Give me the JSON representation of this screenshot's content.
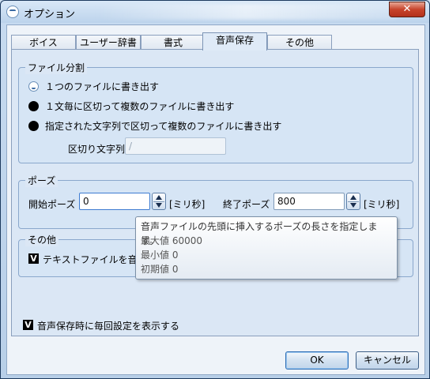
{
  "window": {
    "title": "オプション",
    "close_label": "✕"
  },
  "tabs": [
    {
      "label": "ボイス"
    },
    {
      "label": "ユーザー辞書"
    },
    {
      "label": "書式"
    },
    {
      "label": "音声保存",
      "active": true
    },
    {
      "label": "その他"
    }
  ],
  "file_split": {
    "title": "ファイル分割",
    "options": [
      {
        "label": "１つのファイルに書き出す",
        "selected": true
      },
      {
        "label": "１文毎に区切って複数のファイルに書き出す",
        "selected": false
      },
      {
        "label": "指定された文字列で区切って複数のファイルに書き出す",
        "selected": false
      }
    ],
    "delimiter_label": "区切り文字列",
    "delimiter_value": "/"
  },
  "pause": {
    "title": "ポーズ",
    "start_label": "開始ポーズ",
    "start_value": "0",
    "end_label": "終了ポーズ",
    "end_value": "800",
    "unit": "[ミリ秒]"
  },
  "other": {
    "title": "その他",
    "text_file_checkbox_label": "テキストファイルを音",
    "text_file_checked": true
  },
  "tooltip": {
    "line1": "音声ファイルの先頭に挿入するポーズの長さを指定します。",
    "line2": "最大値 60000",
    "line3": "最小値 0",
    "line4": "初期値 0"
  },
  "show_settings": {
    "label": "音声保存時に毎回設定を表示する",
    "checked": true
  },
  "checkbox_mark": "V",
  "buttons": {
    "ok": "OK",
    "cancel": "キャンセル"
  },
  "colors": {
    "accent": "#3a6aa3",
    "close_button": "#c7432b"
  }
}
